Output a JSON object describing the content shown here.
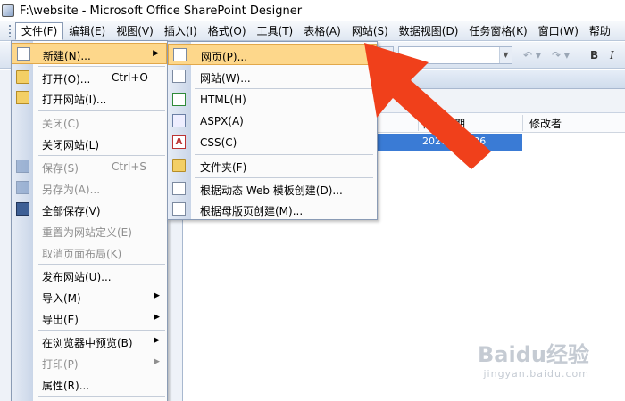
{
  "window": {
    "title": "F:\\website - Microsoft Office SharePoint Designer"
  },
  "menubar": {
    "items": [
      "文件(F)",
      "编辑(E)",
      "视图(V)",
      "插入(I)",
      "格式(O)",
      "工具(T)",
      "表格(A)",
      "网站(S)",
      "数据视图(D)",
      "任务窗格(K)",
      "窗口(W)",
      "帮助"
    ]
  },
  "list": {
    "col_modified": "修改日期",
    "col_modifier": "修改者",
    "selected_row_text": "2020/…  …36"
  },
  "file_menu": {
    "items": [
      {
        "label": "新建(N)...",
        "has_submenu": true,
        "highlighted": true
      },
      {
        "label": "打开(O)...",
        "shortcut": "Ctrl+O"
      },
      {
        "label": "打开网站(I)..."
      },
      {
        "label": "关闭(C)",
        "disabled": true
      },
      {
        "label": "关闭网站(L)"
      },
      {
        "label": "保存(S)",
        "shortcut": "Ctrl+S",
        "disabled": true
      },
      {
        "label": "另存为(A)...",
        "disabled": true
      },
      {
        "label": "全部保存(V)"
      },
      {
        "label": "重置为网站定义(E)",
        "disabled": true
      },
      {
        "label": "取消页面布局(K)",
        "disabled": true
      },
      {
        "label": "发布网站(U)..."
      },
      {
        "label": "导入(M)",
        "has_submenu": true
      },
      {
        "label": "导出(E)",
        "has_submenu": true
      },
      {
        "label": "在浏览器中预览(B)",
        "has_submenu": true
      },
      {
        "label": "打印(P)",
        "has_submenu": true,
        "disabled": true
      },
      {
        "label": "属性(R)..."
      }
    ]
  },
  "new_submenu": {
    "items": [
      {
        "label": "网页(P)...",
        "highlighted": true
      },
      {
        "label": "网站(W)..."
      },
      {
        "label": "HTML(H)"
      },
      {
        "label": "ASPX(A)"
      },
      {
        "label": "CSS(C)"
      },
      {
        "label": "文件夹(F)"
      },
      {
        "label": "根据动态 Web 模板创建(D)..."
      },
      {
        "label": "根据母版页创建(M)..."
      }
    ]
  },
  "toolbar": {
    "bold": "B",
    "italic": "I"
  },
  "watermark": {
    "logo": "Baidu经验",
    "url": "jingyan.baidu.com"
  },
  "colors": {
    "highlight": "#fdd78b",
    "highlight_border": "#e2a84a",
    "selection": "#3a7bd5",
    "arrow": "#f0401b"
  }
}
